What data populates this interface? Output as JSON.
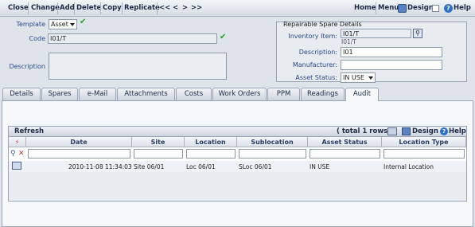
{
  "toolbar": {
    "close": "Close",
    "change": "Change",
    "add": "Add",
    "delete": "Delete",
    "copy": "Copy",
    "replicate": "Replicate",
    "nav_first": "<<",
    "nav_prev": "<",
    "nav_next": ">",
    "nav_last": ">>",
    "home": "Home",
    "menu": "Menu",
    "design": "Design",
    "help": "Help"
  },
  "form": {
    "template_label": "Template",
    "template_value": "Asset",
    "code_label": "Code",
    "code_value": "I01/T",
    "description_label": "Description",
    "description_value": ""
  },
  "repairable": {
    "title": "Repairable Spare Details",
    "inventory_label": "Inventory Item:",
    "inventory_value": "I01/T",
    "inventory_sub": "I01/T",
    "description_label": "Description:",
    "description_value": "I01",
    "manufacturer_label": "Manufacturer:",
    "manufacturer_value": "",
    "asset_status_label": "Asset Status:",
    "asset_status_value": "IN USE"
  },
  "tabs": [
    "Details",
    "Spares",
    "e-Mail",
    "Attachments",
    "Costs",
    "Work Orders",
    "PPM",
    "Readings",
    "Audit"
  ],
  "active_tab": "Audit",
  "grid": {
    "refresh": "Refresh",
    "rows_info": "( total 1 rows )",
    "design": "Design",
    "help": "Help",
    "columns": [
      "Date",
      "Site",
      "Location",
      "Sublocation",
      "Asset Status",
      "Location Type"
    ],
    "rows": [
      [
        "2010-11-08 11:34:03",
        "Site 06/01",
        "Loc 06/01",
        "SLoc 06/01",
        "IN USE",
        "Internal Location"
      ]
    ]
  },
  "colors": {
    "label": "#2b4b8a",
    "accent_green": "#2e9a2e",
    "tab_bg": "#dfe3ea"
  }
}
